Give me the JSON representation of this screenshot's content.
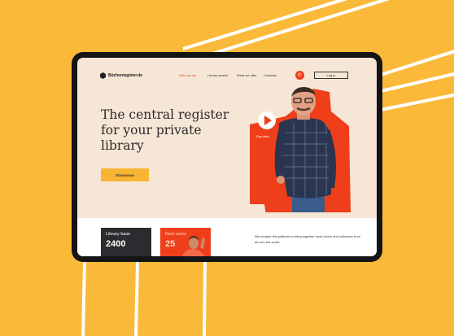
{
  "brand": {
    "name": "Büchernegister.de"
  },
  "nav": {
    "items": [
      {
        "label": "Who we are",
        "active": true
      },
      {
        "label": "Library search"
      },
      {
        "label": "What we offer"
      },
      {
        "label": "Contacts"
      }
    ]
  },
  "header": {
    "login_label": "Log in",
    "phone_icon": "phone-icon"
  },
  "hero": {
    "headline_lines": [
      "The central register",
      "for your private",
      "library"
    ],
    "cta_label": "Showroom",
    "play_label": "Play video"
  },
  "stats": [
    {
      "title": "Library base",
      "value": "2400"
    },
    {
      "title": "New users",
      "value": "25"
    }
  ],
  "about": {
    "text": "We created this platform to bring together book lovers and collectors from all over the world."
  },
  "colors": {
    "background": "#fbb93a",
    "accent": "#ef3f1a",
    "screen": "#f6e6d6",
    "button": "#f8b534"
  }
}
